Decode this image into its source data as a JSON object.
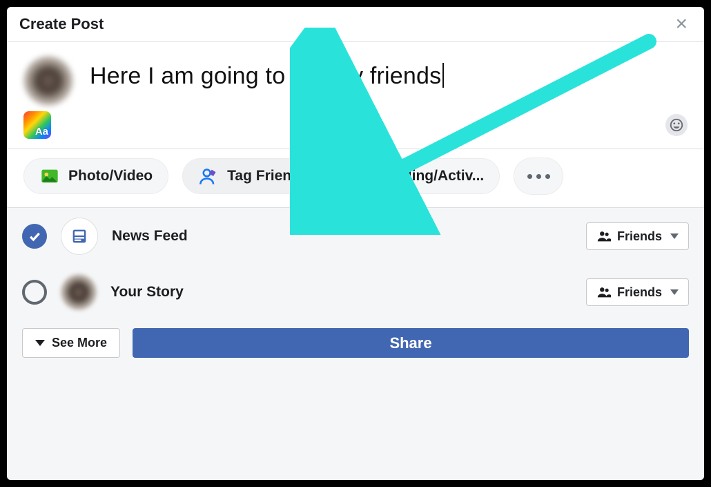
{
  "header": {
    "title": "Create Post"
  },
  "composer": {
    "text": "Here I am going to tag my friends"
  },
  "background_picker": {
    "thumb_label": "Aa"
  },
  "pills": {
    "photo_video": "Photo/Video",
    "tag_friends": "Tag Friends",
    "feeling_activity": "Feeling/Activ..."
  },
  "destinations": {
    "news_feed": {
      "label": "News Feed",
      "audience": "Friends"
    },
    "your_story": {
      "label": "Your Story",
      "audience": "Friends"
    }
  },
  "footer": {
    "see_more": "See More",
    "share": "Share"
  },
  "annotation": {
    "arrow_color": "#29e3db",
    "arrow_target": "tag-friends-pill"
  }
}
